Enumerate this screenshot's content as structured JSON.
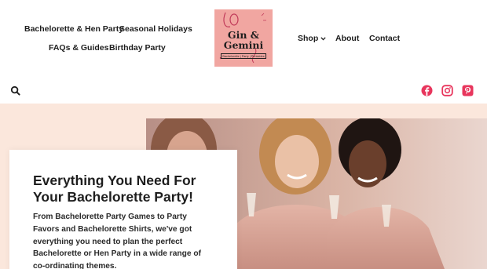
{
  "nav": {
    "left": [
      "Bachelorette & Hen Party",
      "Seasonal Holidays",
      "FAQs & Guides",
      "Birthday Party"
    ],
    "right": [
      "Shop",
      "About",
      "Contact"
    ]
  },
  "logo": {
    "line1": "Gin &",
    "line2": "Gemini",
    "tagline": "Bachelorette | Party | Printables"
  },
  "icons": {
    "search": "search-icon",
    "facebook": "facebook-icon",
    "instagram": "instagram-icon",
    "pinterest": "pinterest-icon",
    "shop_chevron": "chevron-down-icon"
  },
  "hero": {
    "title": "Everything You Need For Your Bachelorette Party!",
    "body": "From Bachelorette Party Games to Party Favors and Bachelorette Shirts, we've got everything you need to plan the perfect Bachelorette or Hen Party in a wide range of co-ordinating themes."
  },
  "colors": {
    "text": "#1e1e1e",
    "social": "#e8365d",
    "band": "#fbe7dc",
    "logo_bg": "#f1a6a1"
  }
}
